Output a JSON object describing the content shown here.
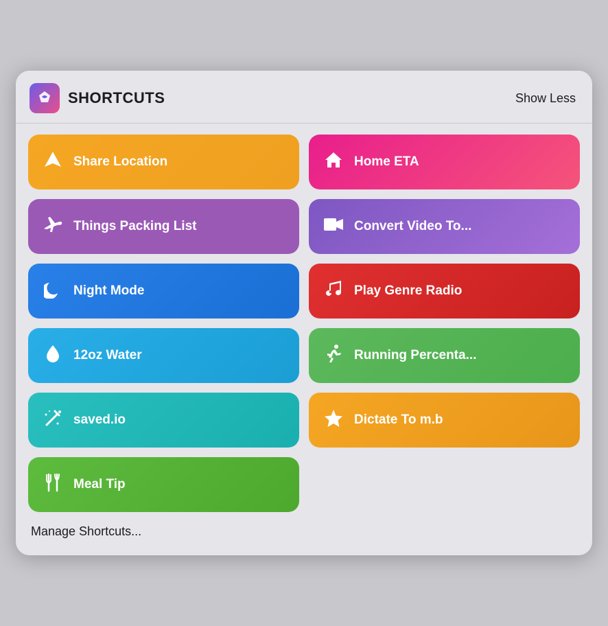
{
  "header": {
    "app_icon": "⬡",
    "title": "SHORTCUTS",
    "show_less": "Show Less"
  },
  "shortcuts": [
    {
      "id": "share-location",
      "label": "Share Location",
      "icon": "navigation",
      "icon_unicode": "➤",
      "color_class": "btn-orange",
      "col": 0
    },
    {
      "id": "home-eta",
      "label": "Home ETA",
      "icon": "home",
      "icon_unicode": "⌂",
      "color_class": "btn-pink-red",
      "col": 1
    },
    {
      "id": "things-packing-list",
      "label": "Things Packing List",
      "icon": "plane",
      "icon_unicode": "✈",
      "color_class": "btn-purple",
      "col": 0
    },
    {
      "id": "convert-video",
      "label": "Convert Video To...",
      "icon": "video",
      "icon_unicode": "▶",
      "color_class": "btn-purple-mid",
      "col": 1
    },
    {
      "id": "night-mode",
      "label": "Night Mode",
      "icon": "moon",
      "icon_unicode": "☽",
      "color_class": "btn-blue",
      "col": 0
    },
    {
      "id": "play-genre-radio",
      "label": "Play Genre Radio",
      "icon": "music",
      "icon_unicode": "♪",
      "color_class": "btn-red",
      "col": 1
    },
    {
      "id": "12oz-water",
      "label": "12oz Water",
      "icon": "water",
      "icon_unicode": "◆",
      "color_class": "btn-blue-light",
      "col": 0
    },
    {
      "id": "running-percentage",
      "label": "Running Percenta...",
      "icon": "run",
      "icon_unicode": "⚡",
      "color_class": "btn-green",
      "col": 1
    },
    {
      "id": "saved-io",
      "label": "saved.io",
      "icon": "magic",
      "icon_unicode": "✦",
      "color_class": "btn-teal",
      "col": 0
    },
    {
      "id": "dictate-to-mb",
      "label": "Dictate To m.b",
      "icon": "star",
      "icon_unicode": "★",
      "color_class": "btn-orange-yellow",
      "col": 1
    },
    {
      "id": "meal-tip",
      "label": "Meal Tip",
      "icon": "utensils",
      "icon_unicode": "✗",
      "color_class": "btn-green-bright",
      "col": 0,
      "single": true
    }
  ],
  "manage_shortcuts": "Manage Shortcuts..."
}
